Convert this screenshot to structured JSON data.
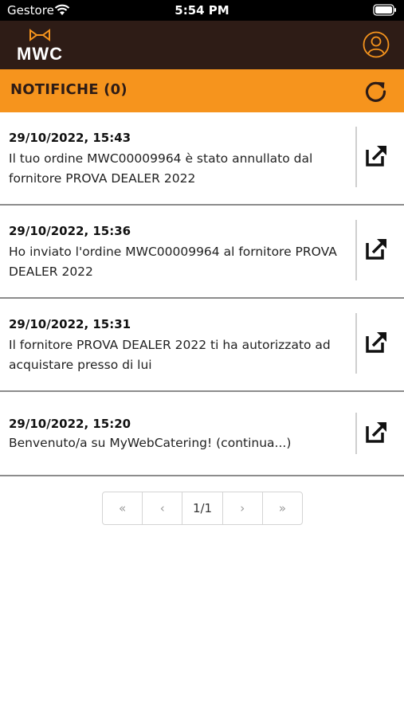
{
  "status_bar": {
    "carrier": "Gestore",
    "time": "5:54 PM"
  },
  "app": {
    "logo_text": "MWC",
    "brand_colors": {
      "header": "#2e1c16",
      "accent": "#f6941d"
    }
  },
  "header": {
    "title": "NOTIFICHE (0)"
  },
  "notifications": [
    {
      "date": "29/10/2022, 15:43",
      "message": "Il tuo ordine MWC00009964 è stato annullato dal fornitore PROVA DEALER 2022"
    },
    {
      "date": "29/10/2022, 15:36",
      "message": "Ho inviato l'ordine MWC00009964 al fornitore PROVA DEALER 2022"
    },
    {
      "date": "29/10/2022, 15:31",
      "message": "Il fornitore PROVA DEALER 2022 ti ha autorizzato ad acquistare presso di lui"
    },
    {
      "date": "29/10/2022, 15:20",
      "message": "Benvenuto/a su MyWebCatering! (continua...)"
    }
  ],
  "pagination": {
    "first": "«",
    "prev": "‹",
    "current": "1/1",
    "next": "›",
    "last": "»"
  }
}
